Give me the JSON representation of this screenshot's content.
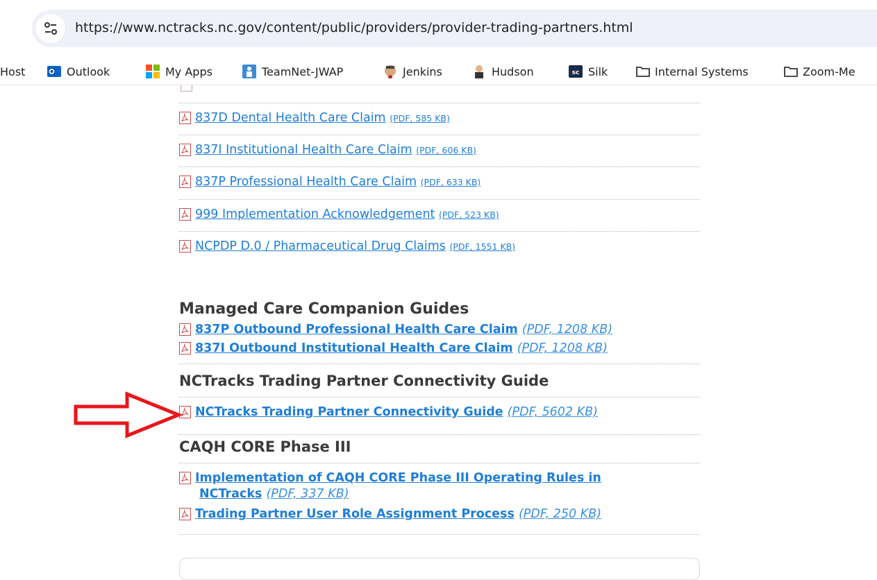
{
  "browser": {
    "url": "https://www.nctracks.nc.gov/content/public/providers/provider-trading-partners.html",
    "bookmarks": [
      {
        "label": "Host",
        "icon": "none"
      },
      {
        "label": "Outlook",
        "icon": "outlook-icon"
      },
      {
        "label": "My Apps",
        "icon": "microsoft-apps-icon"
      },
      {
        "label": "TeamNet-JWAP",
        "icon": "teamnet-icon"
      },
      {
        "label": "Jenkins",
        "icon": "jenkins-icon"
      },
      {
        "label": "Hudson",
        "icon": "hudson-icon"
      },
      {
        "label": "Silk",
        "icon": "silk-icon"
      },
      {
        "label": "Internal Systems",
        "icon": "folder-icon"
      },
      {
        "label": "Zoom-Me",
        "icon": "folder-icon"
      }
    ]
  },
  "guides": [
    {
      "title": "837D Dental Health Care Claim",
      "meta": "(PDF, 585 KB)"
    },
    {
      "title": "837I Institutional Health Care Claim",
      "meta": "(PDF, 606 KB)"
    },
    {
      "title": "837P Professional Health Care Claim",
      "meta": "(PDF, 633 KB)"
    },
    {
      "title": "999 Implementation Acknowledgement",
      "meta": "(PDF, 523 KB)"
    },
    {
      "title": "NCPDP D.0 / Pharmaceutical Drug Claims",
      "meta": "(PDF, 1551 KB)"
    }
  ],
  "managed_care": {
    "heading": "Managed Care Companion Guides",
    "items": [
      {
        "title": "837P Outbound Professional Health Care Claim",
        "meta": "(PDF, 1208 KB)"
      },
      {
        "title": "837I Outbound Institutional Health Care Claim",
        "meta": "(PDF, 1208 KB)"
      }
    ]
  },
  "connectivity": {
    "heading": "NCTracks Trading Partner Connectivity Guide",
    "items": [
      {
        "title": "NCTracks Trading Partner Connectivity Guide",
        "meta": "(PDF, 5602 KB)"
      }
    ]
  },
  "caqh": {
    "heading": "CAQH CORE Phase III",
    "items": [
      {
        "title_line1": "Implementation of CAQH CORE Phase III Operating Rules in",
        "title_line2": "NCTracks",
        "meta": "(PDF, 337 KB)"
      },
      {
        "title": "Trading Partner User Role Assignment Process",
        "meta": "(PDF, 250 KB)"
      }
    ]
  },
  "colors": {
    "link": "#1f7ed6",
    "arrow": "#e8161b",
    "heading": "#3a3a3a"
  }
}
